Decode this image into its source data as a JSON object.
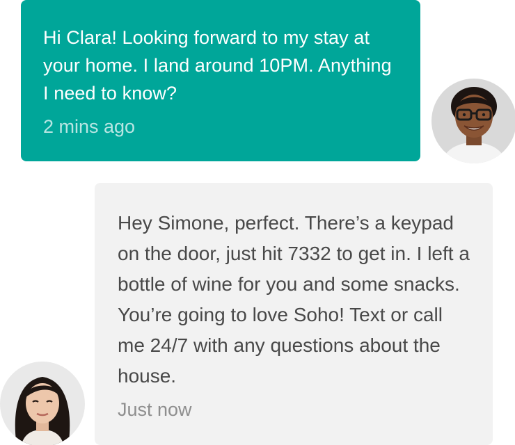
{
  "messages": [
    {
      "sender": "Simone",
      "direction": "outgoing",
      "text": "Hi Clara! Looking forward to my stay at your home. I land around 10PM. Anything I need to know?",
      "timestamp": "2 mins ago",
      "avatar_icon": "user-avatar-simone"
    },
    {
      "sender": "Clara",
      "direction": "incoming",
      "text": "Hey Simone, perfect. There’s a keypad on the door, just hit 7332 to get in. I left a bottle of wine for you and some snacks. You’re going to love Soho! Text or call me 24/7 with any questions about the house.",
      "timestamp": "Just now",
      "avatar_icon": "user-avatar-clara"
    }
  ],
  "colors": {
    "outgoing_bubble": "#00a699",
    "incoming_bubble": "#f2f2f2",
    "incoming_text": "#484848",
    "outgoing_text": "#ffffff"
  }
}
